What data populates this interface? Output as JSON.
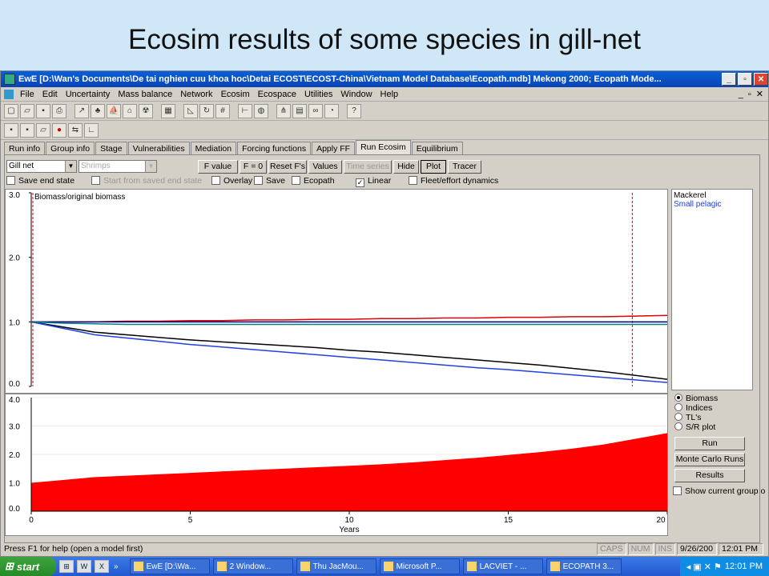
{
  "slide": {
    "title": "Ecosim results of some species in gill-net"
  },
  "window": {
    "title": "EwE [D:\\Wan's Documents\\De tai nghien cuu khoa hoc\\Detai ECOST\\ECOST-China\\Vietnam Model Database\\Ecopath.mdb] Mekong 2000; Ecopath Mode...",
    "buttons": {
      "min": "_",
      "max": "▫",
      "close": "✕"
    }
  },
  "menu": {
    "items": [
      "File",
      "Edit",
      "Uncertainty",
      "Mass balance",
      "Network",
      "Ecosim",
      "Ecospace",
      "Utilities",
      "Window",
      "Help"
    ],
    "mdi": [
      "_",
      "▫",
      "✕"
    ]
  },
  "tabs": [
    "Run info",
    "Group info",
    "Stage",
    "Vulnerabilities",
    "Mediation",
    "Forcing functions",
    "Apply FF",
    "Run Ecosim",
    "Equilibrium"
  ],
  "controls": {
    "fleet_select": "Gill net",
    "group_select": "Shrimps",
    "buttons": [
      "F value",
      "F = 0",
      "Reset F's",
      "Values",
      "Time series",
      "Hide",
      "Plot",
      "Tracer"
    ],
    "checks": {
      "save_end_state": "Save end state",
      "start_from_saved": "Start from saved end state",
      "overlay": "Overlay",
      "save": "Save",
      "ecopath": "Ecopath",
      "linear": "Linear",
      "fleet_effort": "Fleet/effort dynamics"
    }
  },
  "top_plot": {
    "label": "Biomass/original biomass",
    "y_ticks": [
      "3.0",
      "2.0",
      "1.0",
      "0.0"
    ]
  },
  "bottom_plot": {
    "y_ticks": [
      "4.0",
      "3.0",
      "2.0",
      "1.0",
      "0.0"
    ],
    "x_ticks": [
      "0",
      "5",
      "10",
      "15",
      "20"
    ],
    "x_label": "Years"
  },
  "legend": {
    "items": [
      {
        "label": "Mackerel",
        "color": "#000000"
      },
      {
        "label": "Small pelagic",
        "color": "#2040e0"
      }
    ]
  },
  "side_panel": {
    "radios": [
      "Biomass",
      "Indices",
      "TL's",
      "S/R plot"
    ],
    "run": "Run",
    "monte_carlo": "Monte Carlo Runs",
    "results": "Results",
    "show_current": "Show current group o"
  },
  "status": {
    "help": "Press F1 for help (open a model first)",
    "caps": "CAPS",
    "num": "NUM",
    "ins": "INS",
    "date": "9/26/200",
    "time": "12:01 PM"
  },
  "taskbar": {
    "start": "start",
    "quick": [
      "⊞",
      "W",
      "X"
    ],
    "chev": "»",
    "items": [
      "EwE [D:\\Wa...",
      "2 Window...",
      "Thu JacMou...",
      "Microsoft P...",
      "LACVIET - ...",
      "ECOPATH 3..."
    ],
    "clock": "12:01 PM"
  },
  "chart_data": [
    {
      "type": "line",
      "ylabel": "Biomass/original biomass",
      "ylim": [
        0,
        3
      ],
      "x": [
        0,
        1,
        2,
        3,
        4,
        5,
        6,
        7,
        8,
        9,
        10,
        11,
        12,
        13,
        14,
        15,
        16,
        17,
        18,
        19,
        20
      ],
      "series": [
        {
          "name": "Mackerel",
          "color": "#000000",
          "values": [
            1.0,
            0.92,
            0.84,
            0.8,
            0.76,
            0.72,
            0.69,
            0.66,
            0.63,
            0.6,
            0.56,
            0.53,
            0.49,
            0.45,
            0.41,
            0.37,
            0.33,
            0.28,
            0.23,
            0.17,
            0.11
          ]
        },
        {
          "name": "Small pelagic",
          "color": "#2040e0",
          "values": [
            1.0,
            0.9,
            0.8,
            0.75,
            0.7,
            0.65,
            0.61,
            0.57,
            0.53,
            0.49,
            0.45,
            0.41,
            0.37,
            0.33,
            0.29,
            0.26,
            0.22,
            0.18,
            0.14,
            0.1,
            0.06
          ]
        },
        {
          "color": "#e00000",
          "values": [
            1.0,
            1.0,
            1.0,
            1.01,
            1.01,
            1.02,
            1.02,
            1.03,
            1.03,
            1.04,
            1.04,
            1.05,
            1.05,
            1.06,
            1.06,
            1.07,
            1.07,
            1.08,
            1.08,
            1.09,
            1.1
          ]
        },
        {
          "color": "#000080",
          "values": [
            1.0,
            1.0,
            1.0,
            1.0,
            1.0,
            1.0,
            1.0,
            1.0,
            1.0,
            1.0,
            1.0,
            1.0,
            1.0,
            1.0,
            1.0,
            1.0,
            1.0,
            1.0,
            1.0,
            1.0,
            1.0
          ]
        },
        {
          "color": "#008080",
          "values": [
            1.0,
            0.98,
            0.97,
            0.96,
            0.96,
            0.96,
            0.96,
            0.96,
            0.96,
            0.96,
            0.96,
            0.96,
            0.96,
            0.96,
            0.96,
            0.96,
            0.96,
            0.96,
            0.96,
            0.96,
            0.96
          ]
        }
      ]
    },
    {
      "type": "area",
      "xlabel": "Years",
      "xlim": [
        0,
        20
      ],
      "ylim": [
        0,
        4
      ],
      "x": [
        0,
        1,
        2,
        3,
        4,
        5,
        6,
        7,
        8,
        9,
        10,
        11,
        12,
        13,
        14,
        15,
        16,
        17,
        18,
        19,
        20
      ],
      "series": [
        {
          "color": "#ff0000",
          "values": [
            1.0,
            1.1,
            1.2,
            1.25,
            1.3,
            1.35,
            1.4,
            1.45,
            1.5,
            1.55,
            1.6,
            1.65,
            1.72,
            1.8,
            1.88,
            1.98,
            2.08,
            2.2,
            2.35,
            2.55,
            2.75
          ]
        }
      ]
    }
  ]
}
